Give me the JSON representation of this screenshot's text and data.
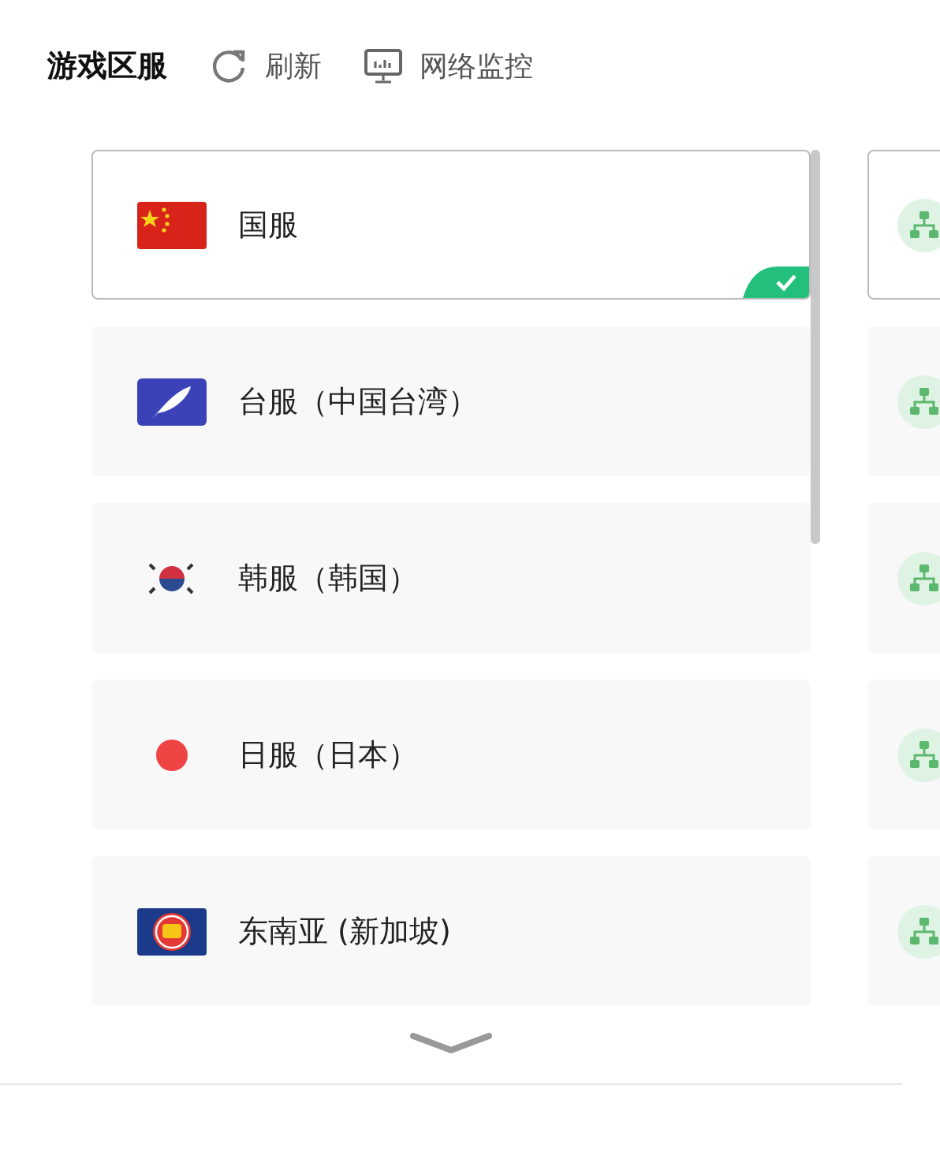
{
  "header": {
    "title": "游戏区服",
    "actions": [
      {
        "kind": "refresh",
        "label": "刷新"
      },
      {
        "kind": "monitor",
        "label": "网络监控"
      }
    ]
  },
  "servers": [
    {
      "name": "国服",
      "kind": "china",
      "selected": true
    },
    {
      "name": "台服（中国台湾）",
      "kind": "taiwan",
      "selected": false
    },
    {
      "name": "韩服（韩国）",
      "kind": "korea",
      "selected": false
    },
    {
      "name": "日服（日本）",
      "kind": "japan",
      "selected": false
    },
    {
      "name": "东南亚 (新加坡)",
      "kind": "asean",
      "selected": false
    }
  ]
}
